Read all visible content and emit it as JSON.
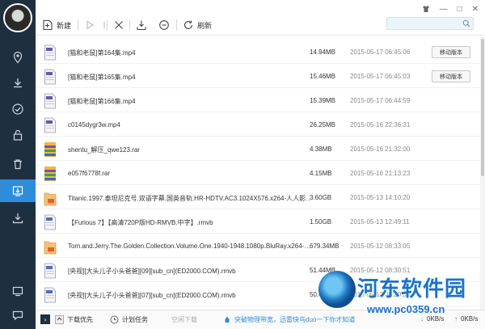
{
  "toolbar": {
    "new_label": "新建",
    "refresh_label": "刷新",
    "search_placeholder": ""
  },
  "window_controls": [
    "shirt-icon",
    "—",
    "□",
    "✕"
  ],
  "sidebar": {
    "items": [
      {
        "icon": "location-icon"
      },
      {
        "icon": "download-icon"
      },
      {
        "icon": "check-icon"
      },
      {
        "icon": "unlock-icon"
      },
      {
        "icon": "trash-icon"
      },
      {
        "icon": "cloud-download-icon",
        "active": true
      },
      {
        "icon": "tray-download-icon"
      },
      {
        "icon": "screen-icon"
      },
      {
        "icon": "chat-icon"
      }
    ]
  },
  "files": [
    {
      "type": "mp4",
      "name": "[猫和老鼠]第164集.mp4",
      "size": "14.94MB",
      "time": "2015-05-17  06:45:06",
      "action": "移动版本"
    },
    {
      "type": "mp4",
      "name": "[猫和老鼠]第165集.mp4",
      "size": "15.46MB",
      "time": "2015-05-17  06:45:03",
      "action": "移动版本"
    },
    {
      "type": "mp4",
      "name": "[猫和老鼠]第166集.mp4",
      "size": "15.39MB",
      "time": "2015-05-17  06:44:59",
      "action": ""
    },
    {
      "type": "mp4",
      "name": "c0145dygr3w.mp4",
      "size": "26.25MB",
      "time": "2015-05-16  22:36:31",
      "action": ""
    },
    {
      "type": "rar",
      "name": "shentu_解压_qwe123.rar",
      "size": "4.38MB",
      "time": "2015-05-16  21:32:00",
      "action": ""
    },
    {
      "type": "rar",
      "name": "e057f6778f.rar",
      "size": "4.15MB",
      "time": "2015-05-16  21:13:23",
      "action": ""
    },
    {
      "type": "bt",
      "name": "Titanic.1997.泰坦尼克号.双语字幕.国英音轨.HR-HDTV.AC3.1024X576.x264-人人影…",
      "size": "3.60GB",
      "time": "2015-05-13  14:10:20",
      "action": ""
    },
    {
      "type": "rmvb",
      "name": "【Furious 7】【高清720P版HD-RMVB.中字】.rmvb",
      "size": "1.50GB",
      "time": "2015-05-13  12:49:11",
      "action": ""
    },
    {
      "type": "bt",
      "name": "Tom.and.Jerry.The.Golden.Collection.Volume.One.1940-1948.1080p.BluRay.x264-…",
      "size": "679.34MB",
      "time": "2015-05-12  08:33:05",
      "action": ""
    },
    {
      "type": "rmvb",
      "name": "[央视][大头儿子小头爸爸][09][sub_cn](ED2000.COM).rmvb",
      "size": "51.44MB",
      "time": "2015-05-12  08:30:51",
      "action": ""
    },
    {
      "type": "rmvb",
      "name": "[央视][大头儿子小头爸爸][07][sub_cn](ED2000.COM).rmvb",
      "size": "50.49MB",
      "time": "2015-05-12  08:20:35",
      "action": ""
    }
  ],
  "bottombar": {
    "priority_label": "下载优先",
    "schedule_label": "计划任务",
    "idle_label": "空闲下载",
    "promo_label": "突破物理带宽，迅雷快鸟duo一下你才知道",
    "down_speed": "0KB/s",
    "up_speed": "0KB/s"
  },
  "watermark": {
    "title": "河东软件园",
    "url": "www.pc0359.cn"
  },
  "colors": {
    "sidebar_bg": "#1e2f40",
    "accent": "#2d8ddb"
  }
}
